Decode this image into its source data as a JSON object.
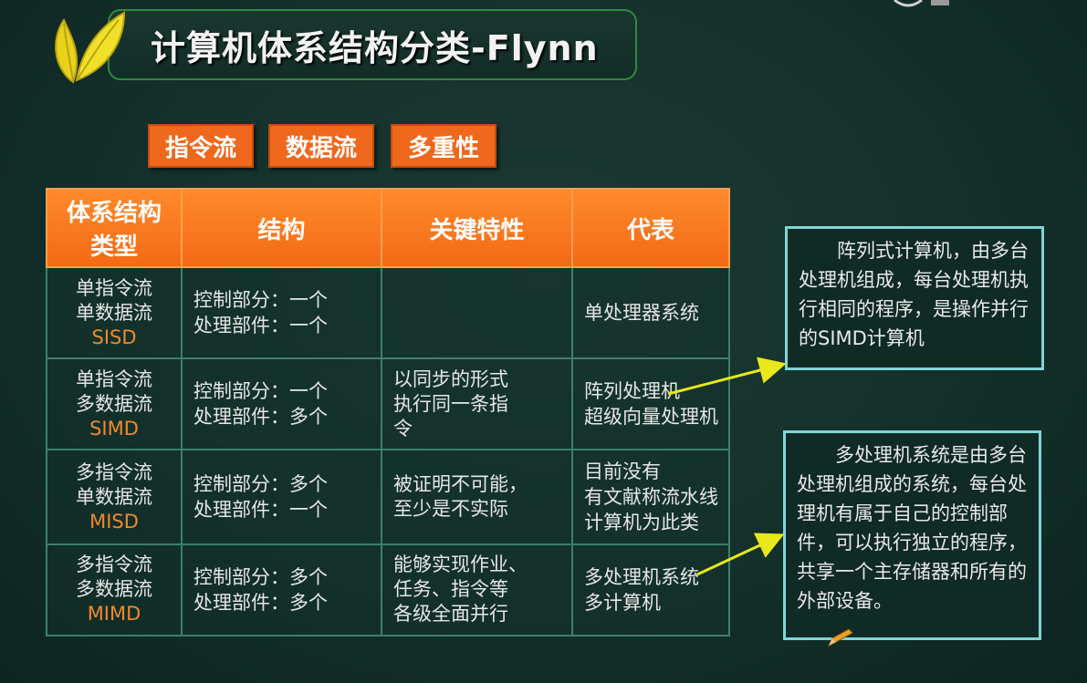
{
  "slide": {
    "title": "计算机体系结构分类-Flynn",
    "tags": [
      "指令流",
      "数据流",
      "多重性"
    ]
  },
  "table": {
    "headers": [
      "体系结构类型",
      "结构",
      "关键特性",
      "代表"
    ],
    "header_type_lines": [
      "体系结构",
      "类型"
    ],
    "rows": [
      {
        "type_lines": [
          "单指令流",
          "单数据流"
        ],
        "abbr": "SISD",
        "structure": [
          "控制部分：一个",
          "处理部件：一个"
        ],
        "key": [],
        "rep": [
          "单处理器系统"
        ]
      },
      {
        "type_lines": [
          "单指令流",
          "多数据流"
        ],
        "abbr": "SIMD",
        "structure": [
          "控制部分：一个",
          "处理部件：多个"
        ],
        "key": [
          "以同步的形式",
          "执行同一条指",
          "令"
        ],
        "rep": [
          "阵列处理机",
          "超级向量处理机"
        ]
      },
      {
        "type_lines": [
          "多指令流",
          "单数据流"
        ],
        "abbr": "MISD",
        "structure": [
          "控制部分：多个",
          "处理部件：一个"
        ],
        "key": [
          "被证明不可能，",
          "至少是不实际"
        ],
        "rep": [
          "目前没有",
          "有文献称流水线",
          "计算机为此类"
        ]
      },
      {
        "type_lines": [
          "多指令流",
          "多数据流"
        ],
        "abbr": "MIMD",
        "structure": [
          "控制部分：多个",
          "处理部件：多个"
        ],
        "key": [
          "能够实现作业、",
          "任务、指令等",
          "各级全面并行"
        ],
        "rep": [
          "多处理机系统",
          "多计算机"
        ]
      }
    ]
  },
  "notes": {
    "simd": "阵列式计算机，由多台处理机组成，每台处理机执行相同的程序，是操作并行的SIMD计算机",
    "mimd": "多处理机系统是由多台处理机组成的系统，每台处理机有属于自己的控制部件，可以执行独立的程序，共享一个主存储器和所有的外部设备。"
  },
  "colors": {
    "background": "#14302a",
    "accent": "#f0681c",
    "rep_text": "#ff8c2a",
    "note_border": "#7fd6d6",
    "arrow": "#e8e81a"
  }
}
